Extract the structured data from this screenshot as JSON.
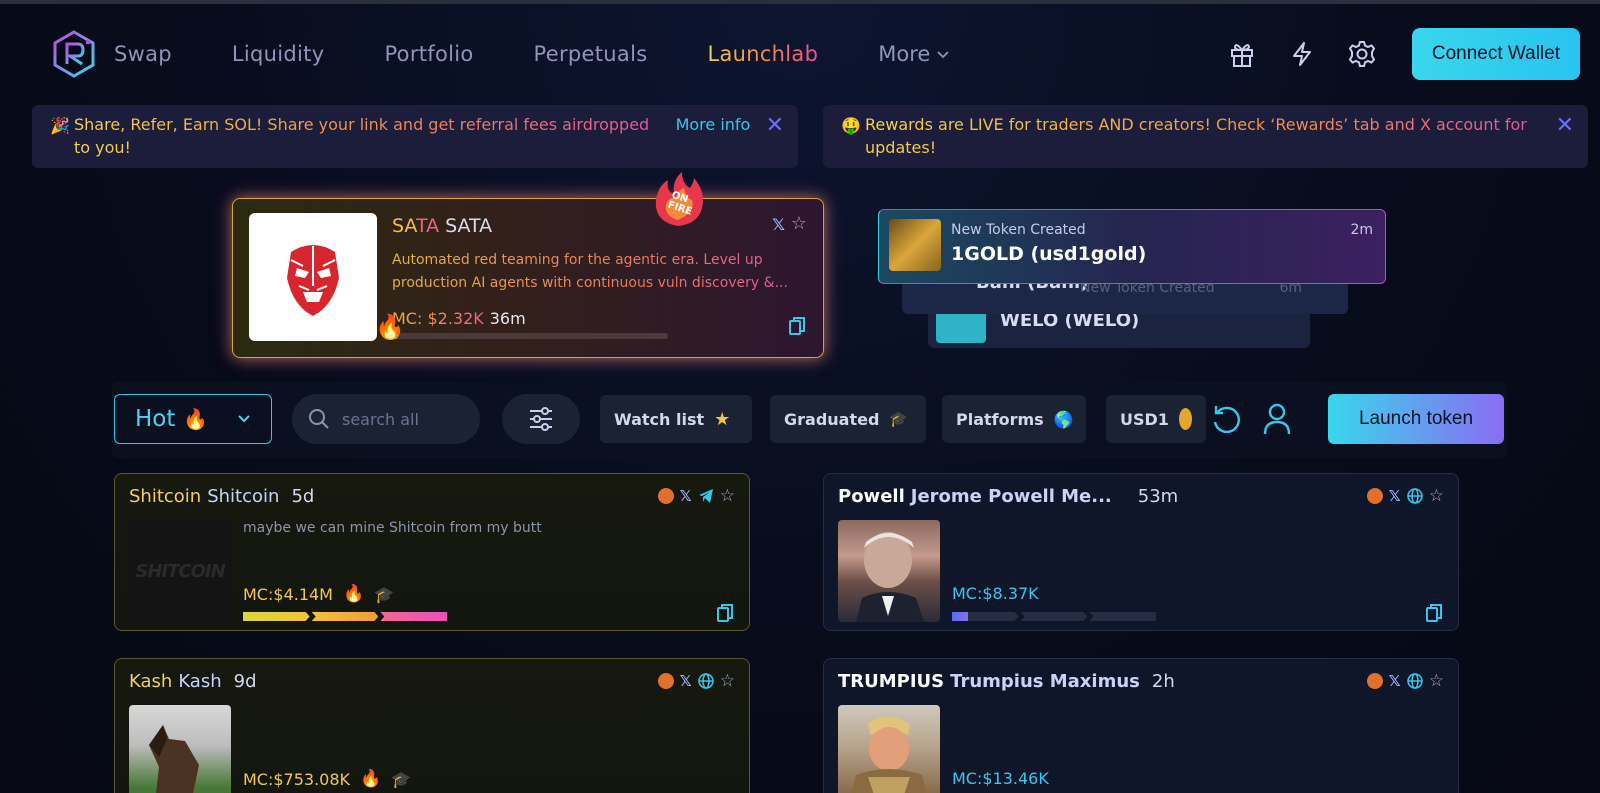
{
  "nav": {
    "links": [
      "Swap",
      "Liquidity",
      "Portfolio",
      "Perpetuals",
      "Launchlab"
    ],
    "more": "More",
    "connect": "Connect Wallet"
  },
  "banners": [
    {
      "emoji": "🎉",
      "text": "Share, Refer, Earn SOL! Share your link and get referral fees airdropped to you!",
      "link": "More info"
    },
    {
      "emoji": "🤑",
      "text": "Rewards are LIVE for traders AND creators! Check ‘Rewards’ tab and X account for updates!"
    }
  ],
  "featured": {
    "symbol_a": "SATA",
    "name": "SATA",
    "description": "Automated red teaming for the agentic era. Level up production AI agents with continuous vuln discovery &...",
    "mc": "MC: $2.32K",
    "age": "36m",
    "badge": "ON FIRE",
    "progress": 0.02
  },
  "stack": [
    {
      "label": "New Token Created",
      "title": "1GOLD (usd1gold)",
      "time": "2m"
    },
    {
      "label": "New Token Created",
      "title": "Bani (Bani)",
      "time": "6m"
    },
    {
      "title": "WELO (WELO)"
    }
  ],
  "filters": {
    "sort": "Hot",
    "search_placeholder": "search all",
    "chips": [
      "Watch list",
      "Graduated",
      "Platforms",
      "USD1"
    ],
    "launch": "Launch token"
  },
  "tokens": [
    {
      "symbol": "Shitcoin",
      "name": "Shitcoin",
      "age": "5d",
      "desc": "maybe we can mine Shitcoin from my butt",
      "mc": "MC:$4.14M",
      "logo_text": "SHITCOIN",
      "progress": 1.0
    },
    {
      "symbol": "Powell",
      "name": "Jerome Powell Me...",
      "age": "53m",
      "mc": "MC:$8.37K",
      "progress": 0.08
    },
    {
      "symbol": "Kash",
      "name": "Kash",
      "age": "9d",
      "mc": "MC:$753.08K"
    },
    {
      "symbol": "TRUMPIUS",
      "name": "Trumpius Maximus",
      "age": "2h",
      "mc": "MC:$13.46K"
    }
  ],
  "icons": {
    "pump": "pump-icon",
    "x": "x-icon",
    "telegram": "telegram-icon",
    "globe": "globe-icon",
    "star": "star-icon",
    "copy": "copy-icon"
  },
  "colors": {
    "accent": "#39d6ec",
    "launchlab": "#f58a3a",
    "purple": "#8a6cf3"
  }
}
